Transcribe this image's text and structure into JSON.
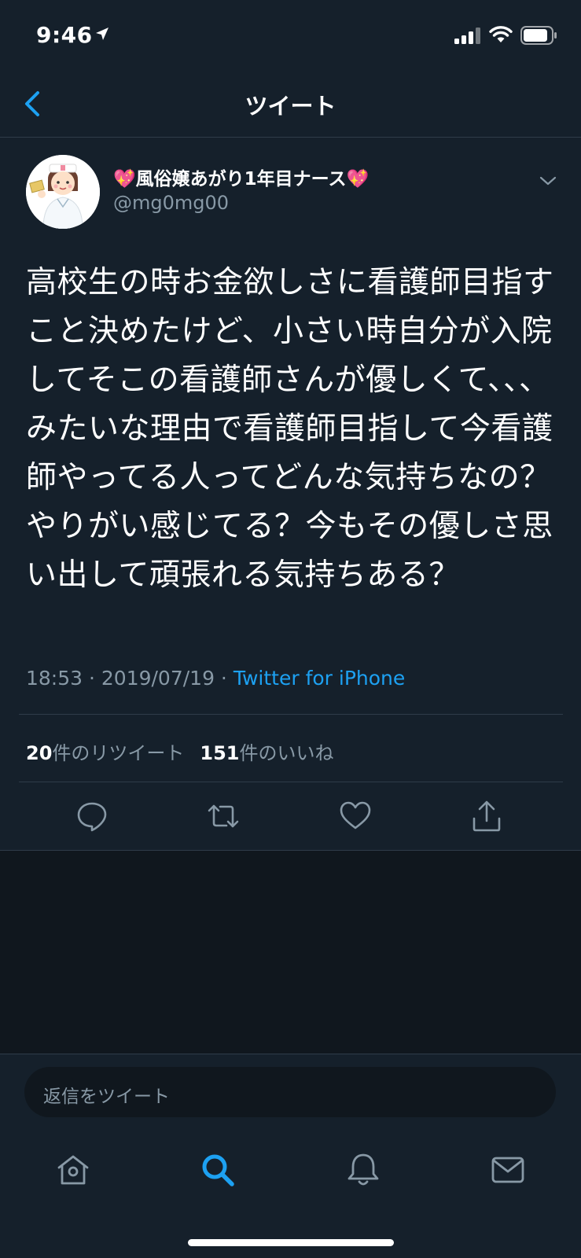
{
  "status_bar": {
    "time": "9:46"
  },
  "nav": {
    "title": "ツイート"
  },
  "tweet": {
    "display_name": "💖風俗嬢あがり1年目ナース💖",
    "handle": "@mg0mg00",
    "text": "高校生の時お金欲しさに看護師目指すこと決めたけど、小さい時自分が入院してそこの看護師さんが優しくて、、、みたいな理由で看護師目指して今看護師やってる人ってどんな気持ちなの？やりがい感じてる？今もその優しさ思い出して頑張れる気持ちある？",
    "timestamp": "18:53 · 2019/07/19 · ",
    "source": "Twitter for iPhone",
    "retweet_count": "20",
    "retweet_label": "件のリツイート",
    "like_count": "151",
    "like_label": "件のいいね"
  },
  "reply": {
    "placeholder": "返信をツイート"
  },
  "colors": {
    "background": "#15202b",
    "accent": "#1da1f2",
    "secondary_text": "#8899a6",
    "border": "#2f3c49"
  },
  "icons": {
    "actions": [
      "reply-icon",
      "retweet-icon",
      "like-icon",
      "share-icon"
    ],
    "tabs": [
      "home-icon",
      "search-icon",
      "notifications-icon",
      "messages-icon"
    ]
  }
}
